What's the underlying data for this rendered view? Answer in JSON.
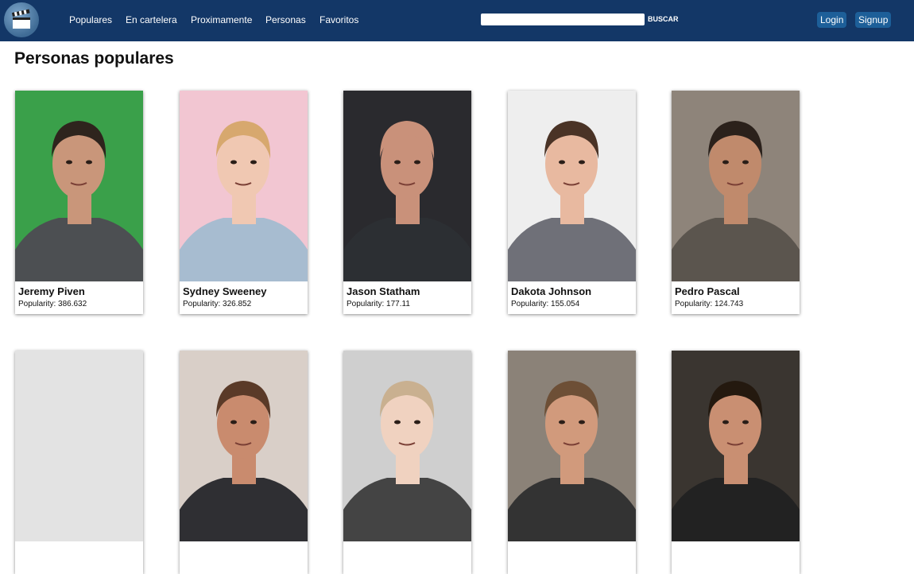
{
  "navbar": {
    "logo_icon": "clapperboard-icon",
    "links": [
      "Populares",
      "En cartelera",
      "Proximamente",
      "Personas",
      "Favoritos"
    ],
    "search": {
      "placeholder": "",
      "value": "",
      "button_label": "BUSCAR"
    },
    "login_label": "Login",
    "signup_label": "Signup"
  },
  "page": {
    "title": "Personas populares"
  },
  "popularity_label": "Popularity:",
  "people": [
    {
      "name": "Jeremy Piven",
      "popularity": "386.632",
      "photo_bg": "#3aa04a",
      "skin": "#c9967a",
      "hair": "#2e241d",
      "clothes": "#4c4f52"
    },
    {
      "name": "Sydney Sweeney",
      "popularity": "326.852",
      "photo_bg": "#f2c6d2",
      "skin": "#f0c8b2",
      "hair": "#d7a86e",
      "clothes": "#a7bcd0"
    },
    {
      "name": "Jason Statham",
      "popularity": "177.11",
      "photo_bg": "#2a2a2e",
      "skin": "#c9917a",
      "hair": "#c9917a",
      "clothes": "#2c2f33"
    },
    {
      "name": "Dakota Johnson",
      "popularity": "155.054",
      "photo_bg": "#eeeeee",
      "skin": "#e8b9a0",
      "hair": "#4a3326",
      "clothes": "#6f7078"
    },
    {
      "name": "Pedro Pascal",
      "popularity": "124.743",
      "photo_bg": "#8e847a",
      "skin": "#c08a6c",
      "hair": "#2b211b",
      "clothes": "#5b554e"
    },
    {
      "name": "",
      "popularity": "",
      "photo_bg": "#e3e3e3",
      "skin": "",
      "hair": "",
      "clothes": ""
    },
    {
      "name": "",
      "popularity": "",
      "photo_bg": "#d9cfc8",
      "skin": "#c98b6e",
      "hair": "#5a3a28",
      "clothes": "#2f2f33"
    },
    {
      "name": "",
      "popularity": "",
      "photo_bg": "#cfcfcf",
      "skin": "#f0d2c0",
      "hair": "#c9b090",
      "clothes": "#444"
    },
    {
      "name": "",
      "popularity": "",
      "photo_bg": "#8b8278",
      "skin": "#d19a7c",
      "hair": "#6d4f36",
      "clothes": "#333"
    },
    {
      "name": "",
      "popularity": "",
      "photo_bg": "#3a3530",
      "skin": "#c98f72",
      "hair": "#24190f",
      "clothes": "#222"
    }
  ]
}
